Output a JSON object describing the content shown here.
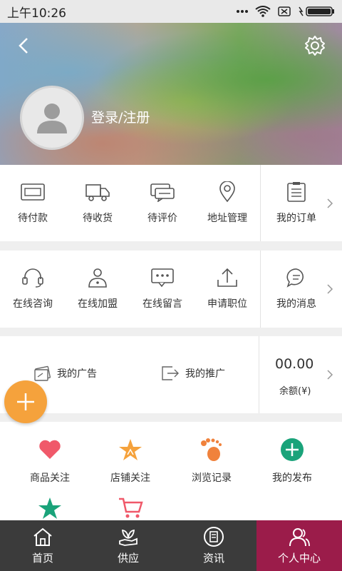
{
  "status": {
    "time": "上午10:26"
  },
  "profile": {
    "login_label": "登录/注册"
  },
  "orders": [
    {
      "label": "待付款",
      "icon": "wallet-icon"
    },
    {
      "label": "待收货",
      "icon": "truck-icon"
    },
    {
      "label": "待评价",
      "icon": "comment-icon"
    },
    {
      "label": "地址管理",
      "icon": "location-pin-icon"
    },
    {
      "label": "我的订单",
      "icon": "order-list-icon"
    }
  ],
  "services": [
    {
      "label": "在线咨询",
      "icon": "headset-icon"
    },
    {
      "label": "在线加盟",
      "icon": "person-icon"
    },
    {
      "label": "在线留言",
      "icon": "message-dots-icon"
    },
    {
      "label": "申请职位",
      "icon": "upload-icon"
    },
    {
      "label": "我的消息",
      "icon": "chat-bubble-icon"
    }
  ],
  "ads": {
    "my_ads": "我的广告",
    "my_promo": "我的推广",
    "balance_amount": "00.00",
    "balance_label": "余额(¥)"
  },
  "quick": [
    {
      "label": "商品关注",
      "icon": "heart-icon",
      "color": "#f0596a"
    },
    {
      "label": "店铺关注",
      "icon": "star-icon",
      "color": "#f5a23c"
    },
    {
      "label": "浏览记录",
      "icon": "footprint-icon",
      "color": "#f0823c"
    },
    {
      "label": "我的发布",
      "icon": "plus-circle-icon",
      "color": "#1aa37a"
    }
  ],
  "tabs": [
    {
      "label": "首页",
      "icon": "home-icon"
    },
    {
      "label": "供应",
      "icon": "supply-icon"
    },
    {
      "label": "资讯",
      "icon": "news-icon"
    },
    {
      "label": "个人中心",
      "icon": "user-center-icon"
    }
  ],
  "colors": {
    "accent": "#9b1c4a",
    "fab": "#f5a23c",
    "tabbar": "#3b3b3b"
  }
}
